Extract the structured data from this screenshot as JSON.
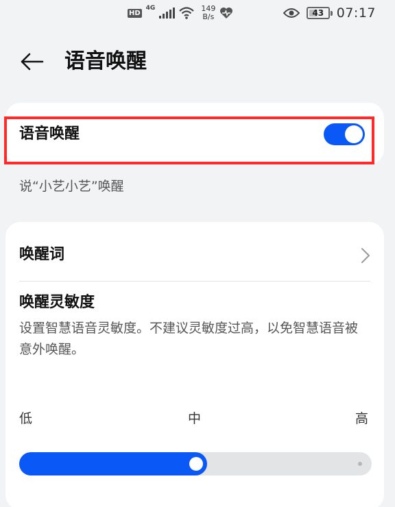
{
  "status_bar": {
    "hd": "HD",
    "network": "4G",
    "speed_value": "149",
    "speed_unit": "B/s",
    "battery": "43",
    "time": "07:17",
    "icons": [
      "signal-icon",
      "wifi-icon",
      "health-heart-icon",
      "eye-comfort-icon",
      "battery-icon"
    ]
  },
  "header": {
    "title": "语音唤醒",
    "back_icon": "arrow-left-icon"
  },
  "wake_toggle": {
    "label": "语音唤醒",
    "enabled": true
  },
  "hint": "说“小艺小艺”唤醒",
  "wake_word": {
    "label": "唤醒词",
    "icon": "chevron-right-icon"
  },
  "sensitivity": {
    "title": "唤醒灵敏度",
    "description": "设置智慧语音灵敏度。不建议灵敏度过高，以免智慧语音被意外唤醒。",
    "low_label": "低",
    "mid_label": "中",
    "high_label": "高",
    "level": 0.5
  },
  "colors": {
    "accent": "#0a59f7",
    "highlight": "#ff2b2b",
    "background": "#f1f3f5"
  }
}
